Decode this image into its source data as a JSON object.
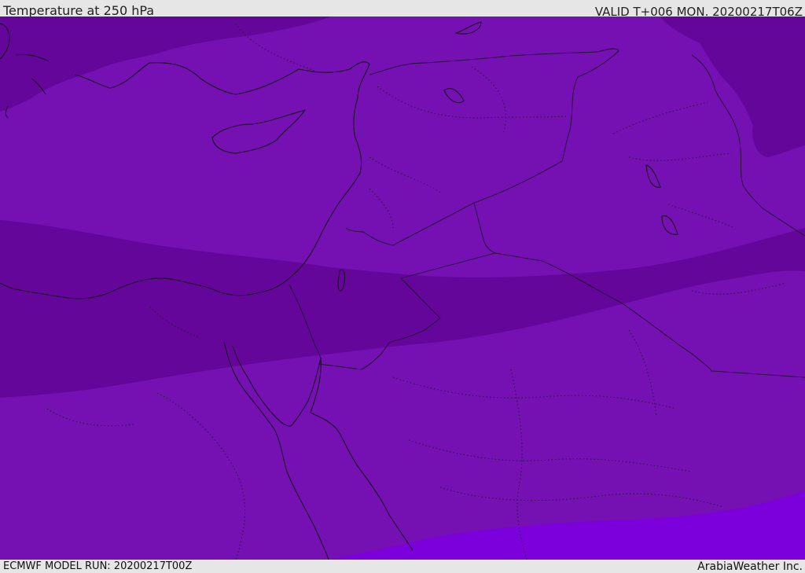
{
  "header": {
    "title": "Temperature at 250 hPa",
    "valid": "VALID T+006 MON. 20200217T06Z"
  },
  "footer": {
    "model_run": "ECMWF MODEL RUN: 20200217T00Z",
    "credit": "ArabiaWeather Inc."
  },
  "map": {
    "colors": {
      "base_purple": "#7510b2",
      "dark_purple": "#65069a",
      "bright_purple": "#7b00dc",
      "coastline": "#1a0d22",
      "border": "#1f0f2b"
    }
  }
}
